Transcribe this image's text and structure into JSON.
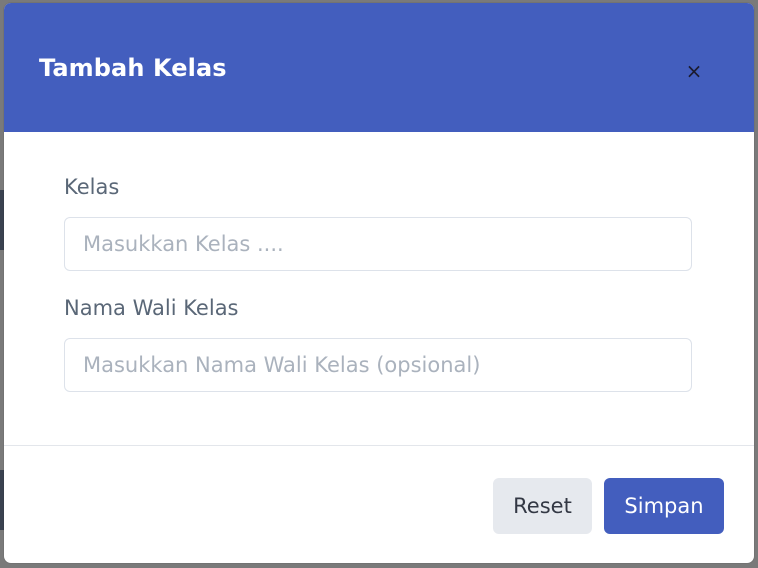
{
  "modal": {
    "title": "Tambah Kelas",
    "close_symbol": "×"
  },
  "form": {
    "kelas": {
      "label": "Kelas",
      "placeholder": "Masukkan Kelas ....",
      "value": ""
    },
    "wali_kelas": {
      "label": "Nama Wali Kelas",
      "placeholder": "Masukkan Nama Wali Kelas (opsional)",
      "value": ""
    }
  },
  "footer": {
    "reset_label": "Reset",
    "save_label": "Simpan"
  },
  "colors": {
    "primary": "#435ebe",
    "overlay": "#7a7a7a",
    "label_text": "#5a6777",
    "placeholder_text": "#aab2bd",
    "secondary_button": "#e6e9ee"
  },
  "icons": {
    "close": "close-icon"
  }
}
